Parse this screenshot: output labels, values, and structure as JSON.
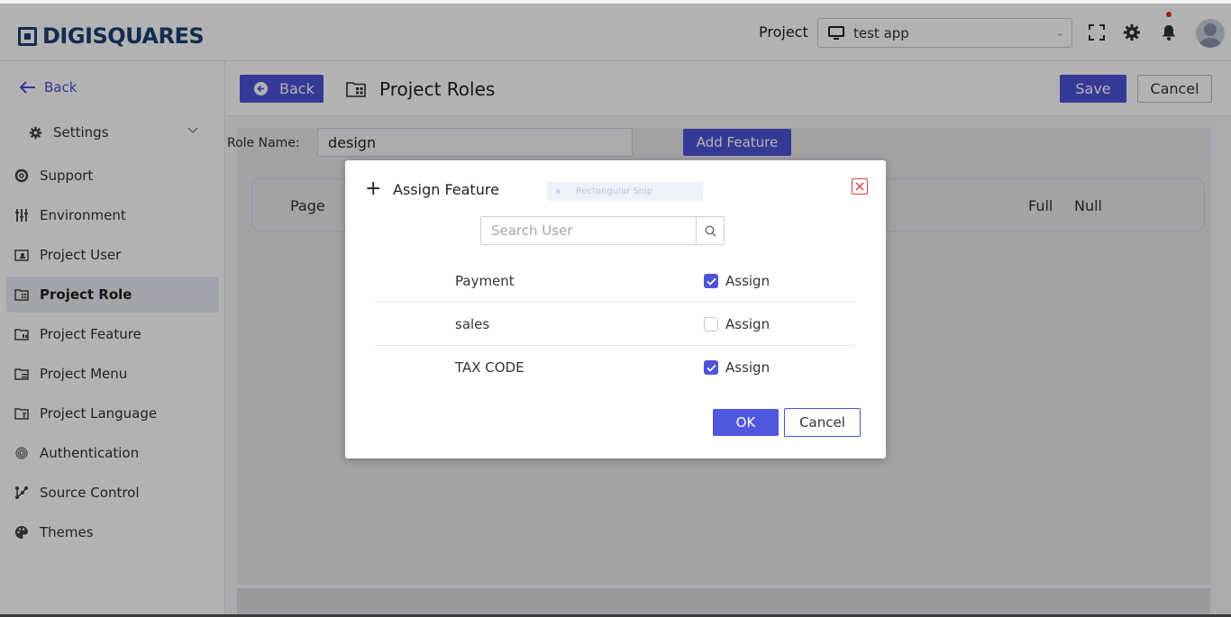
{
  "header": {
    "brand": "DIGISQUARES",
    "project_label": "Project",
    "project_value": "test app"
  },
  "sidebar": {
    "back_label": "Back",
    "settings_label": "Settings",
    "items": [
      {
        "label": "Support",
        "icon": "lifebuoy-icon"
      },
      {
        "label": "Environment",
        "icon": "sliders-icon"
      },
      {
        "label": "Project User",
        "icon": "user-folder-icon"
      },
      {
        "label": "Project Role",
        "icon": "role-folder-icon",
        "active": true
      },
      {
        "label": "Project Feature",
        "icon": "feature-folder-icon"
      },
      {
        "label": "Project Menu",
        "icon": "menu-folder-icon"
      },
      {
        "label": "Project Language",
        "icon": "language-folder-icon"
      },
      {
        "label": "Authentication",
        "icon": "fingerprint-icon"
      },
      {
        "label": "Source Control",
        "icon": "branch-icon"
      },
      {
        "label": "Themes",
        "icon": "palette-icon"
      }
    ]
  },
  "toolbar": {
    "back_label": "Back",
    "title": "Project Roles",
    "save_label": "Save",
    "cancel_label": "Cancel"
  },
  "role": {
    "label": "Role Name:",
    "value": "design",
    "add_feature_label": "Add Feature"
  },
  "table": {
    "col_page": "Page",
    "col_full": "Full",
    "col_null": "Null"
  },
  "modal": {
    "title": "Assign Feature",
    "snip_text": "Rectangular Snip",
    "search_placeholder": "Search User",
    "features": [
      {
        "name": "Payment",
        "assign_label": "Assign",
        "checked": true
      },
      {
        "name": "sales",
        "assign_label": "Assign",
        "checked": false
      },
      {
        "name": "TAX CODE",
        "assign_label": "Assign",
        "checked": true
      }
    ],
    "ok_label": "OK",
    "cancel_label": "Cancel"
  },
  "colors": {
    "accent": "#4e54d8",
    "brand": "#1c3f73",
    "close": "#d94040",
    "notification": "#d9312b"
  }
}
